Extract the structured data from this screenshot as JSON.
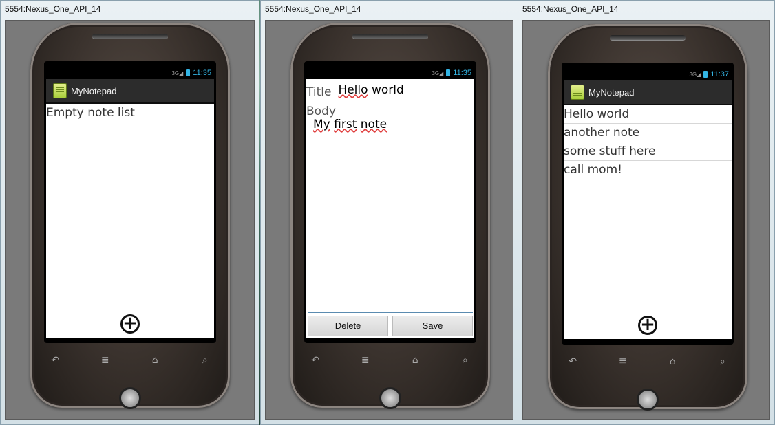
{
  "windows": [
    {
      "title": "5554:Nexus_One_API_14",
      "status_time": "11:35",
      "app_title": "MyNotepad",
      "empty_text": "Empty note list",
      "add_icon": "plus-circle-icon"
    },
    {
      "title": "5554:Nexus_One_API_14",
      "status_time": "11:35",
      "title_label": "Title",
      "title_value_word1": "Hello",
      "title_value_word2": "world",
      "body_label": "Body",
      "body_word1": "My",
      "body_word2": "first",
      "body_word3": "note",
      "delete_label": "Delete",
      "save_label": "Save"
    },
    {
      "title": "5554:Nexus_One_API_14",
      "status_time": "11:37",
      "app_title": "MyNotepad",
      "notes": [
        "Hello world",
        "another note",
        "some stuff here",
        "call mom!"
      ],
      "add_icon": "plus-circle-icon"
    }
  ],
  "nav": {
    "back": "↶",
    "menu": "≣",
    "home": "⌂",
    "search": "⌕"
  },
  "colors": {
    "status_accent": "#33b5e5",
    "action_bar": "#2c2c2c",
    "spell_error": "#e04040"
  }
}
